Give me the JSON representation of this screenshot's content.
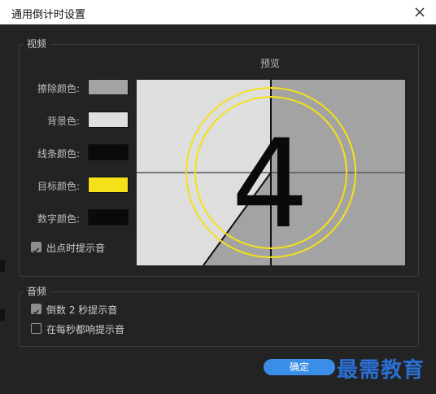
{
  "window": {
    "title": "通用倒计时设置",
    "close_icon": "close-icon"
  },
  "video_group": {
    "legend": "视频",
    "preview_label": "预览",
    "rows": [
      {
        "label": "擦除颜色:",
        "color": "#a3a3a3"
      },
      {
        "label": "背景色:",
        "color": "#dedede"
      },
      {
        "label": "线条颜色:",
        "color": "#0a0a0a"
      },
      {
        "label": "目标颜色:",
        "color": "#f6e01a"
      },
      {
        "label": "数字颜色:",
        "color": "#0a0a0a"
      }
    ],
    "checkbox_cue": {
      "label": "出点时提示音",
      "checked": true
    }
  },
  "preview": {
    "number": "4",
    "target_color": "#f6e01a",
    "wipe_color": "#a3a3a3",
    "bg_color": "#dedede"
  },
  "audio_group": {
    "legend": "音频",
    "items": [
      {
        "label": "倒数 2 秒提示音",
        "checked": true
      },
      {
        "label": "在每秒都响提示音",
        "checked": false
      }
    ]
  },
  "ok_button": {
    "label": "确定"
  },
  "watermark": {
    "text": "最需教育"
  }
}
